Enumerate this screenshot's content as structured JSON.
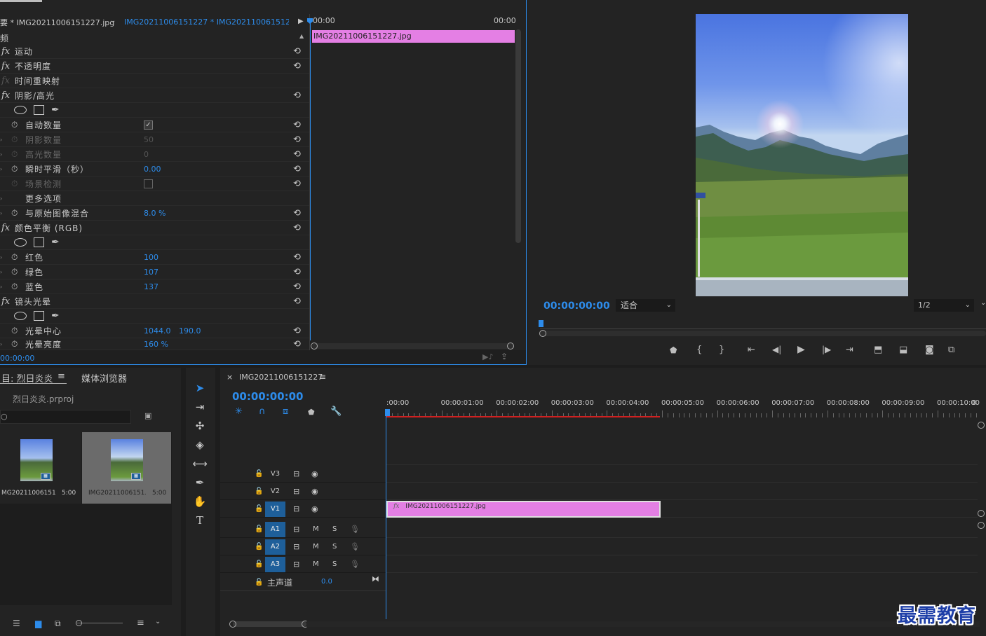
{
  "effect_controls": {
    "tab_prefix": "要 * IMG20211006151227.jpg",
    "breadcrumb": "IMG20211006151227 * IMG20211006151227...",
    "time_start": "00:00",
    "time_end": "00:00",
    "section": "频",
    "clip_name": "IMG20211006151227.jpg",
    "current_time": "00:00:00",
    "rows": {
      "motion": "运动",
      "opacity": "不透明度",
      "time_remap": "时间重映射",
      "shadow_highlight": "阴影/高光",
      "auto_amount": "自动数量",
      "shadow_amount": "阴影数量",
      "shadow_amount_val": "50",
      "highlight_amount": "高光数量",
      "highlight_amount_val": "0",
      "temporal_smooth": "瞬时平滑（秒）",
      "temporal_smooth_val": "0.00",
      "scene_detect": "场景检测",
      "more_options": "更多选项",
      "blend_original": "与原始图像混合",
      "blend_original_val": "8.0 %",
      "color_balance": "颜色平衡 (RGB)",
      "red": "红色",
      "red_val": "100",
      "green": "绿色",
      "green_val": "107",
      "blue": "蓝色",
      "blue_val": "137",
      "lens_flare": "镜头光晕",
      "flare_center": "光晕中心",
      "flare_center_x": "1044.0",
      "flare_center_y": "190.0",
      "flare_brightness": "光晕亮度",
      "flare_brightness_val": "160 %"
    }
  },
  "program": {
    "timecode": "00:00:00:00",
    "fit": "适合",
    "resolution": "1/2"
  },
  "project": {
    "tab_project": "目: 烈日炎炎",
    "tab_media": "媒体浏览器",
    "file": "烈日炎炎.prproj",
    "items": [
      {
        "name": "MG20211006151...",
        "duration": "5:00"
      },
      {
        "name": "IMG20211006151...",
        "duration": "5:00"
      }
    ]
  },
  "timeline": {
    "sequence_name": "IMG20211006151227",
    "timecode": "00:00:00:00",
    "ruler": [
      ":00:00",
      "00:00:01:00",
      "00:00:02:00",
      "00:00:03:00",
      "00:00:04:00",
      "00:00:05:00",
      "00:00:06:00",
      "00:00:07:00",
      "00:00:08:00",
      "00:00:09:00",
      "00:00:10:00",
      "0"
    ],
    "tracks": [
      "V3",
      "V2",
      "V1",
      "A1",
      "A2",
      "A3"
    ],
    "m": "M",
    "s": "S",
    "master": "主声道",
    "master_val": "0.0",
    "clip_name": "IMG20211006151227.jpg"
  },
  "watermark": "最需教育"
}
